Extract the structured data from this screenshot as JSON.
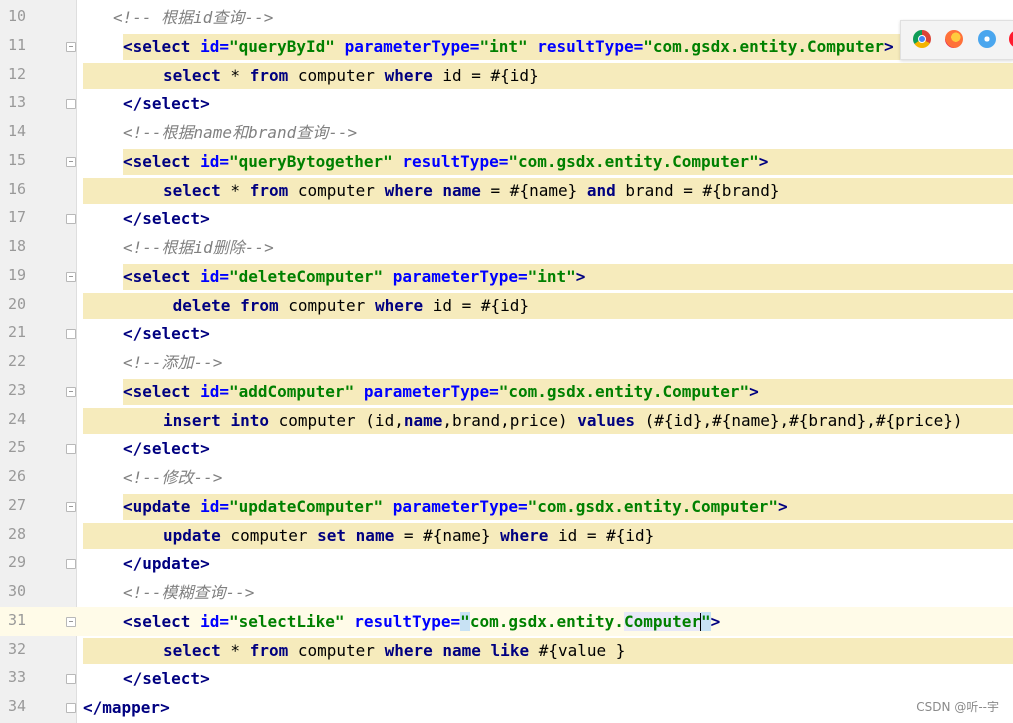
{
  "editor": {
    "lines": [
      {
        "n": "10",
        "indent": 1,
        "hl": false,
        "tokens": [
          {
            "c": "cmt",
            "t": "<!-- 根据id查询-->"
          }
        ]
      },
      {
        "n": "11",
        "indent": 1,
        "hl": true,
        "fold": "open",
        "tokens": [
          {
            "c": "tag",
            "t": "<select "
          },
          {
            "c": "attr",
            "t": "id="
          },
          {
            "c": "val",
            "t": "\"queryById\""
          },
          {
            "c": "plain",
            "t": " "
          },
          {
            "c": "attr",
            "t": "parameterType="
          },
          {
            "c": "val",
            "t": "\"int\""
          },
          {
            "c": "plain",
            "t": " "
          },
          {
            "c": "attr",
            "t": "resultType="
          },
          {
            "c": "val",
            "t": "\"com.gsdx.entity.Computer"
          },
          {
            "c": "tag",
            "t": ">"
          }
        ]
      },
      {
        "n": "12",
        "indent": 2,
        "hl": true,
        "tokens": [
          {
            "c": "kw",
            "t": "select"
          },
          {
            "c": "plain",
            "t": " * "
          },
          {
            "c": "kw",
            "t": "from"
          },
          {
            "c": "plain",
            "t": " computer "
          },
          {
            "c": "kw",
            "t": "where"
          },
          {
            "c": "plain",
            "t": " id = #{id}"
          }
        ]
      },
      {
        "n": "13",
        "indent": 1,
        "hl": false,
        "fold": "close",
        "tokens": [
          {
            "c": "tag",
            "t": "</select>"
          }
        ]
      },
      {
        "n": "14",
        "indent": 1,
        "hl": false,
        "tokens": [
          {
            "c": "cmt",
            "t": "<!--根据name和brand查询-->"
          }
        ]
      },
      {
        "n": "15",
        "indent": 1,
        "hl": true,
        "fold": "open",
        "tokens": [
          {
            "c": "tag",
            "t": "<select "
          },
          {
            "c": "attr",
            "t": "id="
          },
          {
            "c": "val",
            "t": "\"queryBytogether\""
          },
          {
            "c": "plain",
            "t": " "
          },
          {
            "c": "attr",
            "t": "resultType="
          },
          {
            "c": "val",
            "t": "\"com.gsdx.entity.Computer\""
          },
          {
            "c": "tag",
            "t": ">"
          }
        ]
      },
      {
        "n": "16",
        "indent": 2,
        "hl": true,
        "tokens": [
          {
            "c": "kw",
            "t": "select"
          },
          {
            "c": "plain",
            "t": " * "
          },
          {
            "c": "kw",
            "t": "from"
          },
          {
            "c": "plain",
            "t": " computer "
          },
          {
            "c": "kw",
            "t": "where"
          },
          {
            "c": "plain",
            "t": " "
          },
          {
            "c": "kw",
            "t": "name"
          },
          {
            "c": "plain",
            "t": " = #{name} "
          },
          {
            "c": "kw",
            "t": "and"
          },
          {
            "c": "plain",
            "t": " brand = #{brand}"
          }
        ]
      },
      {
        "n": "17",
        "indent": 1,
        "hl": false,
        "fold": "close",
        "tokens": [
          {
            "c": "tag",
            "t": "</select>"
          }
        ]
      },
      {
        "n": "18",
        "indent": 1,
        "hl": false,
        "tokens": [
          {
            "c": "cmt",
            "t": "<!--根据id删除-->"
          }
        ]
      },
      {
        "n": "19",
        "indent": 1,
        "hl": true,
        "fold": "open",
        "tokens": [
          {
            "c": "tag",
            "t": "<select "
          },
          {
            "c": "attr",
            "t": "id="
          },
          {
            "c": "val",
            "t": "\"deleteComputer\""
          },
          {
            "c": "plain",
            "t": " "
          },
          {
            "c": "attr",
            "t": "parameterType="
          },
          {
            "c": "val",
            "t": "\"int\""
          },
          {
            "c": "tag",
            "t": ">"
          }
        ]
      },
      {
        "n": "20",
        "indent": 2,
        "hl": true,
        "tokens": [
          {
            "c": "plain",
            "t": " "
          },
          {
            "c": "kw",
            "t": "delete"
          },
          {
            "c": "plain",
            "t": " "
          },
          {
            "c": "kw",
            "t": "from"
          },
          {
            "c": "plain",
            "t": " computer "
          },
          {
            "c": "kw",
            "t": "where"
          },
          {
            "c": "plain",
            "t": " id = #{id}"
          }
        ]
      },
      {
        "n": "21",
        "indent": 1,
        "hl": false,
        "fold": "close",
        "tokens": [
          {
            "c": "tag",
            "t": "</select>"
          }
        ]
      },
      {
        "n": "22",
        "indent": 1,
        "hl": false,
        "tokens": [
          {
            "c": "cmt",
            "t": "<!--添加-->"
          }
        ]
      },
      {
        "n": "23",
        "indent": 1,
        "hl": true,
        "fold": "open",
        "tokens": [
          {
            "c": "tag",
            "t": "<select "
          },
          {
            "c": "attr",
            "t": "id="
          },
          {
            "c": "val",
            "t": "\"addComputer\""
          },
          {
            "c": "plain",
            "t": " "
          },
          {
            "c": "attr",
            "t": "parameterType="
          },
          {
            "c": "val",
            "t": "\"com.gsdx.entity.Computer\""
          },
          {
            "c": "tag",
            "t": ">"
          }
        ]
      },
      {
        "n": "24",
        "indent": 2,
        "hl": true,
        "tokens": [
          {
            "c": "kw",
            "t": "insert"
          },
          {
            "c": "plain",
            "t": " "
          },
          {
            "c": "kw",
            "t": "into"
          },
          {
            "c": "plain",
            "t": " computer (id,"
          },
          {
            "c": "kw",
            "t": "name"
          },
          {
            "c": "plain",
            "t": ",brand,price) "
          },
          {
            "c": "kw",
            "t": "values"
          },
          {
            "c": "plain",
            "t": " (#{id},#{name},#{brand},#{price})"
          }
        ]
      },
      {
        "n": "25",
        "indent": 1,
        "hl": false,
        "fold": "close",
        "tokens": [
          {
            "c": "tag",
            "t": "</select>"
          }
        ]
      },
      {
        "n": "26",
        "indent": 1,
        "hl": false,
        "tokens": [
          {
            "c": "cmt",
            "t": "<!--修改-->"
          }
        ]
      },
      {
        "n": "27",
        "indent": 1,
        "hl": true,
        "fold": "open",
        "tokens": [
          {
            "c": "tag",
            "t": "<update "
          },
          {
            "c": "attr",
            "t": "id="
          },
          {
            "c": "val",
            "t": "\"updateComputer\""
          },
          {
            "c": "plain",
            "t": " "
          },
          {
            "c": "attr",
            "t": "parameterType="
          },
          {
            "c": "val",
            "t": "\"com.gsdx.entity.Computer\""
          },
          {
            "c": "tag",
            "t": ">"
          }
        ]
      },
      {
        "n": "28",
        "indent": 2,
        "hl": true,
        "tokens": [
          {
            "c": "kw",
            "t": "update"
          },
          {
            "c": "plain",
            "t": " computer "
          },
          {
            "c": "kw",
            "t": "set"
          },
          {
            "c": "plain",
            "t": " "
          },
          {
            "c": "kw",
            "t": "name"
          },
          {
            "c": "plain",
            "t": " = #{name} "
          },
          {
            "c": "kw",
            "t": "where"
          },
          {
            "c": "plain",
            "t": " id = #{id}"
          }
        ]
      },
      {
        "n": "29",
        "indent": 1,
        "hl": false,
        "fold": "close",
        "tokens": [
          {
            "c": "tag",
            "t": "</update>"
          }
        ]
      },
      {
        "n": "30",
        "indent": 1,
        "hl": false,
        "tokens": [
          {
            "c": "cmt",
            "t": "<!--模糊查询-->"
          }
        ]
      },
      {
        "n": "31",
        "indent": 1,
        "hl": false,
        "current": true,
        "fold": "open",
        "tokens": [
          {
            "c": "tag",
            "t": "<select "
          },
          {
            "c": "attr",
            "t": "id="
          },
          {
            "c": "val",
            "t": "\"selectLike\""
          },
          {
            "c": "plain",
            "t": " "
          },
          {
            "c": "attr",
            "t": "resultType="
          },
          {
            "c": "val caret-hl",
            "t": "\""
          },
          {
            "c": "val",
            "t": "com.gsdx.entity."
          },
          {
            "c": "val ref-hl",
            "t": "Computer"
          },
          {
            "c": "cursor",
            "t": ""
          },
          {
            "c": "val caret-hl",
            "t": "\""
          },
          {
            "c": "tag",
            "t": ">"
          }
        ]
      },
      {
        "n": "32",
        "indent": 2,
        "hl": true,
        "tokens": [
          {
            "c": "kw",
            "t": "select"
          },
          {
            "c": "plain",
            "t": " * "
          },
          {
            "c": "kw",
            "t": "from"
          },
          {
            "c": "plain",
            "t": " computer "
          },
          {
            "c": "kw",
            "t": "where"
          },
          {
            "c": "plain",
            "t": " "
          },
          {
            "c": "kw",
            "t": "name"
          },
          {
            "c": "plain",
            "t": " "
          },
          {
            "c": "kw",
            "t": "like"
          },
          {
            "c": "plain",
            "t": " #{value }"
          }
        ]
      },
      {
        "n": "33",
        "indent": 1,
        "hl": false,
        "fold": "close",
        "tokens": [
          {
            "c": "tag",
            "t": "</select>"
          }
        ]
      },
      {
        "n": "34",
        "indent": 0,
        "hl": false,
        "fold": "close",
        "tokens": [
          {
            "c": "tag",
            "t": "</mapper>"
          }
        ]
      }
    ]
  },
  "browser_icons": [
    "chrome-icon",
    "firefox-icon",
    "safari-icon",
    "opera-icon"
  ],
  "watermark": "CSDN @听--宇"
}
